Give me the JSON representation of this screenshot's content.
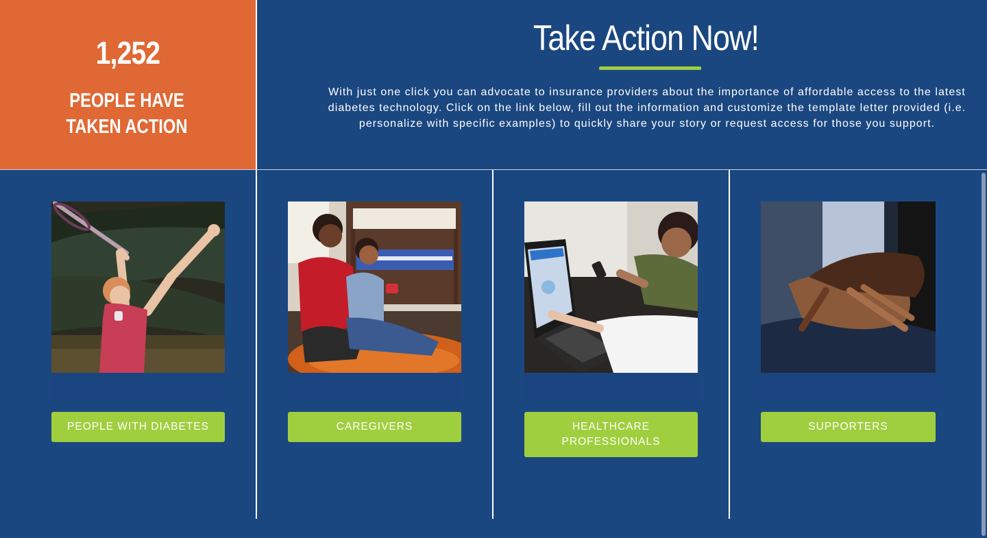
{
  "counter": {
    "number": "1,252",
    "label": "PEOPLE HAVE TAKEN ACTION"
  },
  "header": {
    "title": "Take Action Now!",
    "intro": "With just one click you can advocate to insurance providers about the importance of affordable access to the latest diabetes technology. Click on the link below, fill out the information and customize the template letter provided (i.e. personalize with specific examples) to quickly share your story or request access for those you support."
  },
  "cards": [
    {
      "label": "PEOPLE WITH DIABETES",
      "photo": "woman-playing-tennis-photo"
    },
    {
      "label": "CAREGIVERS",
      "photo": "mother-and-son-photo"
    },
    {
      "label": "HEALTHCARE PROFESSIONALS",
      "photo": "laptop-consultation-photo"
    },
    {
      "label": "SUPPORTERS",
      "photo": "holding-hands-photo"
    }
  ],
  "colors": {
    "background": "#1b4780",
    "accent_orange": "#e06834",
    "accent_green": "#9fcf3e"
  }
}
